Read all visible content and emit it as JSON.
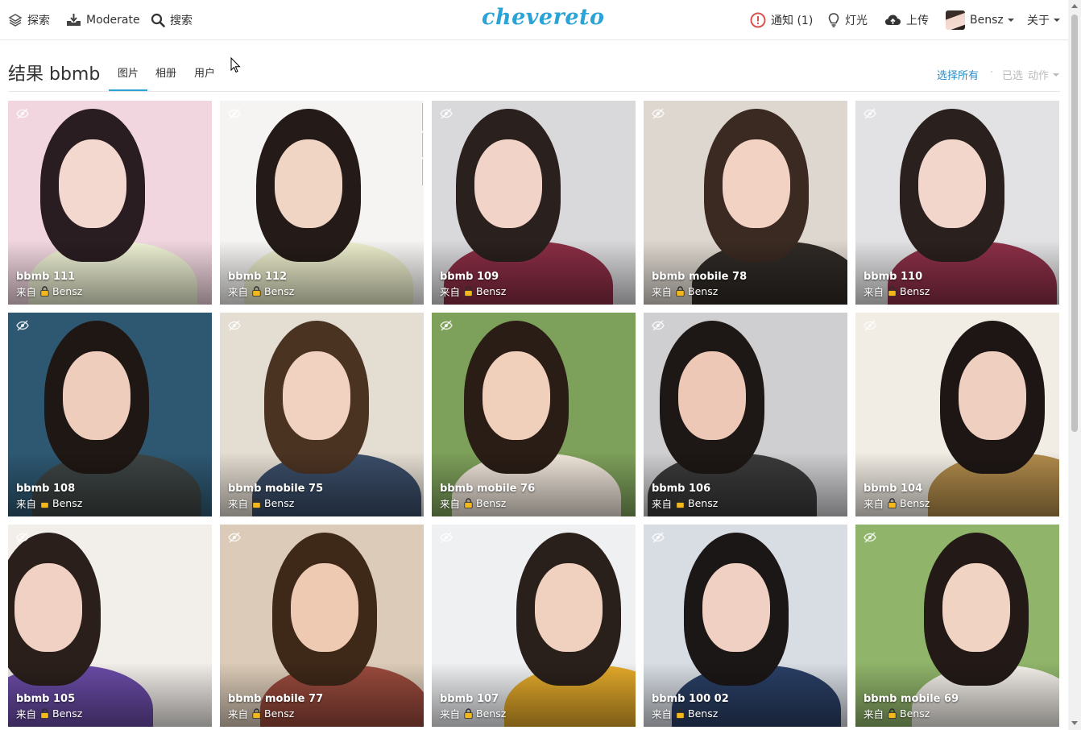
{
  "nav": {
    "explore": "探索",
    "moderate": "Moderate",
    "search": "搜索",
    "logo": "chevereto",
    "notifications": "通知 (1)",
    "lightbox": "灯光",
    "upload": "上传",
    "user": "Bensz",
    "about": "关于"
  },
  "header": {
    "title": "结果 bbmb",
    "tabs": [
      "图片",
      "相册",
      "用户"
    ],
    "active_tab": "图片",
    "select_all": "选择所有",
    "separator": "·",
    "selected": "已选",
    "action": "动作"
  },
  "colors": {
    "accent": "#2aa3d6",
    "link": "#2a8ec9",
    "lock": "#f5b81c",
    "alert": "#d9534f"
  },
  "images": [
    {
      "title": "bbmb 111",
      "from": "来自",
      "owner": "Bensz",
      "bg": "#f1d6df",
      "hair": "#2a1d22",
      "skin": "#f3d8cf",
      "top": "#eef1d4"
    },
    {
      "title": "bbmb 112",
      "from": "来自",
      "owner": "Bensz",
      "bg": "#f5f4f2",
      "hair": "#241b18",
      "skin": "#f0d4c4",
      "top": "#ebeccb"
    },
    {
      "title": "bbmb 109",
      "from": "来自",
      "owner": "Bensz",
      "bg": "#d9d9dc",
      "hair": "#2a201d",
      "skin": "#f2d3c8",
      "top": "#8a2d44"
    },
    {
      "title": "bbmb mobile 78",
      "from": "来自",
      "owner": "Bensz",
      "bg": "#ded7cf",
      "hair": "#3a2a22",
      "skin": "#f2d2c3",
      "top": "#2f2a26"
    },
    {
      "title": "bbmb 110",
      "from": "来自",
      "owner": "Bensz",
      "bg": "#e2e2e4",
      "hair": "#2a201d",
      "skin": "#f3d6cb",
      "top": "#8c2f47"
    },
    {
      "title": "bbmb 108",
      "from": "来自",
      "owner": "Bensz",
      "bg": "#2e5872",
      "hair": "#1f1714",
      "skin": "#efcdbc",
      "top": "#3d4443"
    },
    {
      "title": "bbmb mobile 75",
      "from": "来自",
      "owner": "Bensz",
      "bg": "#e4ddd2",
      "hair": "#4b3322",
      "skin": "#f1d1bf",
      "top": "#3a4d68"
    },
    {
      "title": "bbmb mobile 76",
      "from": "来自",
      "owner": "Bensz",
      "bg": "#7da05a",
      "hair": "#2a1d16",
      "skin": "#f0cfbb",
      "top": "#efe5da"
    },
    {
      "title": "bbmb 106",
      "from": "来自",
      "owner": "Bensz",
      "bg": "#cfcfd2",
      "hair": "#1d1715",
      "skin": "#eec8b6",
      "top": "#3b3a3a"
    },
    {
      "title": "bbmb 104",
      "from": "来自",
      "owner": "Bensz",
      "bg": "#f1ece4",
      "hair": "#1d1615",
      "skin": "#efcfbf",
      "top": "#b08a4a"
    },
    {
      "title": "bbmb 105",
      "from": "来自",
      "owner": "Bensz",
      "bg": "#f2eeea",
      "hair": "#2a1f1b",
      "skin": "#f1d1c3",
      "top": "#6a4ba6"
    },
    {
      "title": "bbmb mobile 77",
      "from": "来自",
      "owner": "Bensz",
      "bg": "#dccbb8",
      "hair": "#3e2818",
      "skin": "#eecab2",
      "top": "#9a4a3c"
    },
    {
      "title": "bbmb 107",
      "from": "来自",
      "owner": "Bensz",
      "bg": "#eef0f2",
      "hair": "#2a201b",
      "skin": "#f0d0be",
      "top": "#e3a92a"
    },
    {
      "title": "bbmb 100 02",
      "from": "来自",
      "owner": "Bensz",
      "bg": "#d8dde4",
      "hair": "#1c1717",
      "skin": "#efd0c2",
      "top": "#2a3f66"
    },
    {
      "title": "bbmb mobile 69",
      "from": "来自",
      "owner": "Bensz",
      "bg": "#8fb46a",
      "hair": "#231a17",
      "skin": "#f1d3c4",
      "top": "#f3efe9"
    }
  ]
}
